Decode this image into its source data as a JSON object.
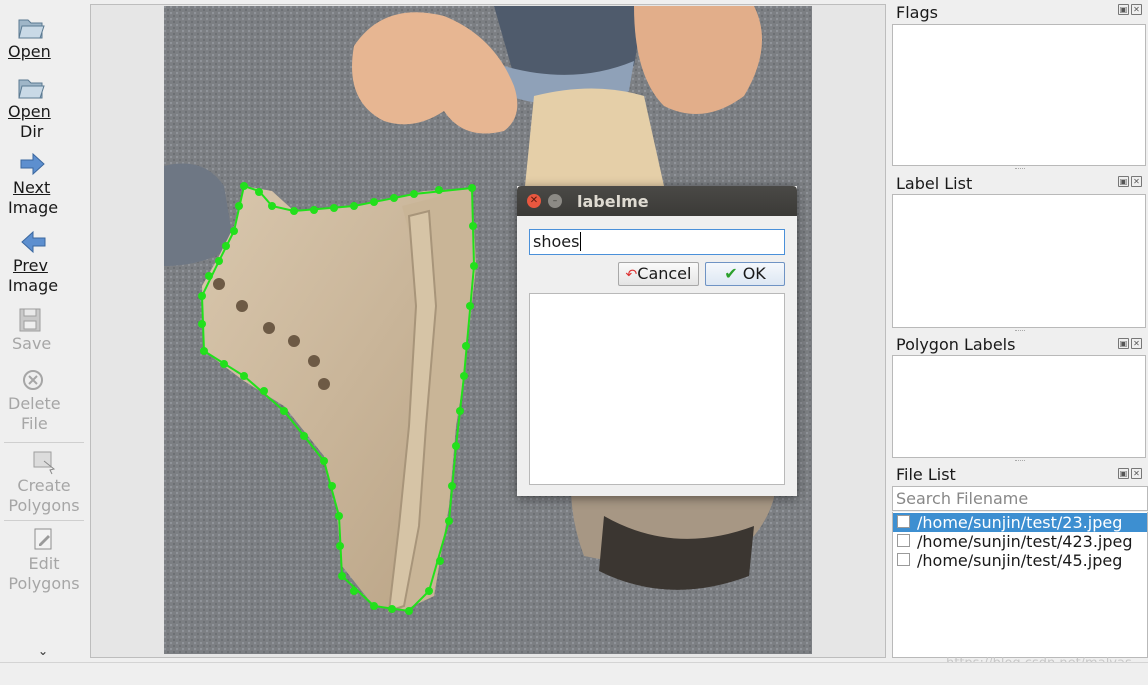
{
  "toolbar": {
    "open": "Open",
    "open_dir_1": "Open",
    "open_dir_2": "Dir",
    "next_1": "Next",
    "next_2": "Image",
    "prev_1": "Prev",
    "prev_2": "Image",
    "save": "Save",
    "delete_1": "Delete",
    "delete_2": "File",
    "create_1": "Create",
    "create_2": "Polygons",
    "edit_1": "Edit",
    "edit_2": "Polygons",
    "more_icon": "chevron-double-down-icon"
  },
  "docks": {
    "flags_title": "Flags",
    "label_list_title": "Label List",
    "polygon_labels_title": "Polygon Labels",
    "file_list_title": "File List",
    "search_placeholder": "Search Filename",
    "files": [
      "/home/sunjin/test/23.jpeg",
      "/home/sunjin/test/423.jpeg",
      "/home/sunjin/test/45.jpeg"
    ],
    "selected_file_index": 0
  },
  "dialog": {
    "title": "labelme",
    "input_value": "shoes",
    "cancel_label": "Cancel",
    "ok_label": "OK"
  },
  "canvas": {
    "polygon_color": "#22e01c",
    "selection_color": "#3d8fd1"
  },
  "watermark": "https://blog.csdn.net/malvas"
}
